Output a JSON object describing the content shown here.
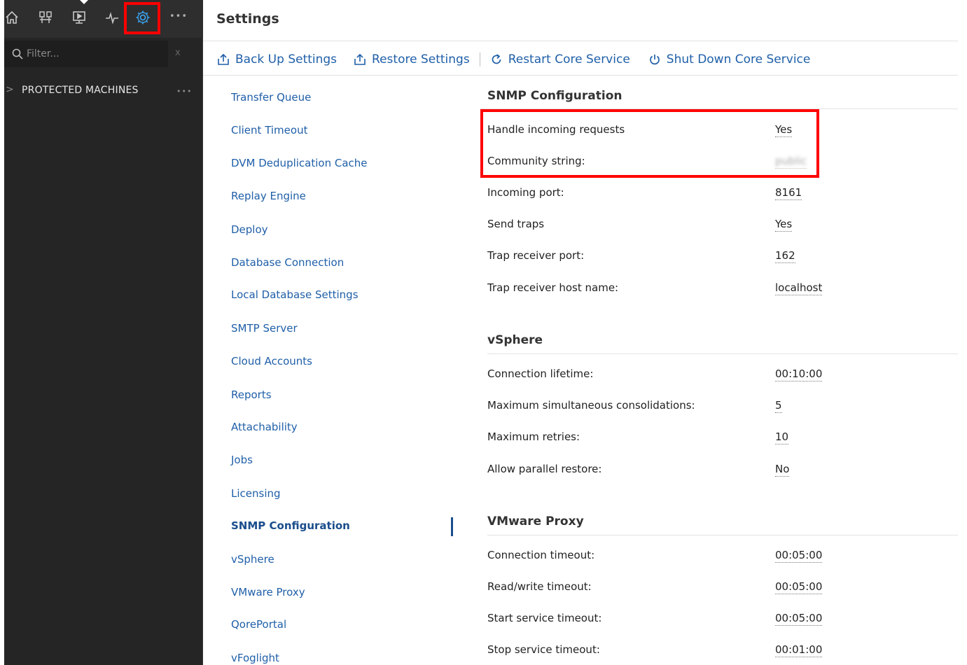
{
  "sidebar": {
    "filter_placeholder": "Filter...",
    "clear_glyph": "x",
    "more_glyph": "•••",
    "protected_machines_label": "PROTECTED MACHINES",
    "chevron_glyph": ">"
  },
  "page": {
    "title": "Settings"
  },
  "toolbar": {
    "backup_label": "Back Up Settings",
    "restore_label": "Restore Settings",
    "restart_label": "Restart Core Service",
    "shutdown_label": "Shut Down Core Service"
  },
  "settings_nav": {
    "items": [
      "Transfer Queue",
      "Client Timeout",
      "DVM Deduplication Cache",
      "Replay Engine",
      "Deploy",
      "Database Connection",
      "Local Database Settings",
      "SMTP Server",
      "Cloud Accounts",
      "Reports",
      "Attachability",
      "Jobs",
      "Licensing",
      "SNMP Configuration",
      "vSphere",
      "VMware Proxy",
      "QorePortal",
      "vFoglight"
    ],
    "active": "SNMP Configuration"
  },
  "snmp": {
    "title": "SNMP Configuration",
    "fields": [
      {
        "label": "Handle incoming requests",
        "value": "Yes"
      },
      {
        "label": "Community string:",
        "value": "public"
      },
      {
        "label": "Incoming port:",
        "value": "8161"
      },
      {
        "label": "Send traps",
        "value": "Yes"
      },
      {
        "label": "Trap receiver port:",
        "value": "162"
      },
      {
        "label": "Trap receiver host name:",
        "value": "localhost"
      }
    ]
  },
  "vsphere": {
    "title": "vSphere",
    "fields": [
      {
        "label": "Connection lifetime:",
        "value": "00:10:00"
      },
      {
        "label": "Maximum simultaneous consolidations:",
        "value": "5"
      },
      {
        "label": "Maximum retries:",
        "value": "10"
      },
      {
        "label": "Allow parallel restore:",
        "value": "No"
      }
    ]
  },
  "vmware_proxy": {
    "title": "VMware Proxy",
    "fields": [
      {
        "label": "Connection timeout:",
        "value": "00:05:00"
      },
      {
        "label": "Read/write timeout:",
        "value": "00:05:00"
      },
      {
        "label": "Start service timeout:",
        "value": "00:05:00"
      },
      {
        "label": "Stop service timeout:",
        "value": "00:01:00"
      }
    ]
  },
  "colors": {
    "accent": "#1f5fa8",
    "highlight": "#ff0000",
    "sidebar_bg": "#252525",
    "settings_icon": "#3aa0e8"
  }
}
